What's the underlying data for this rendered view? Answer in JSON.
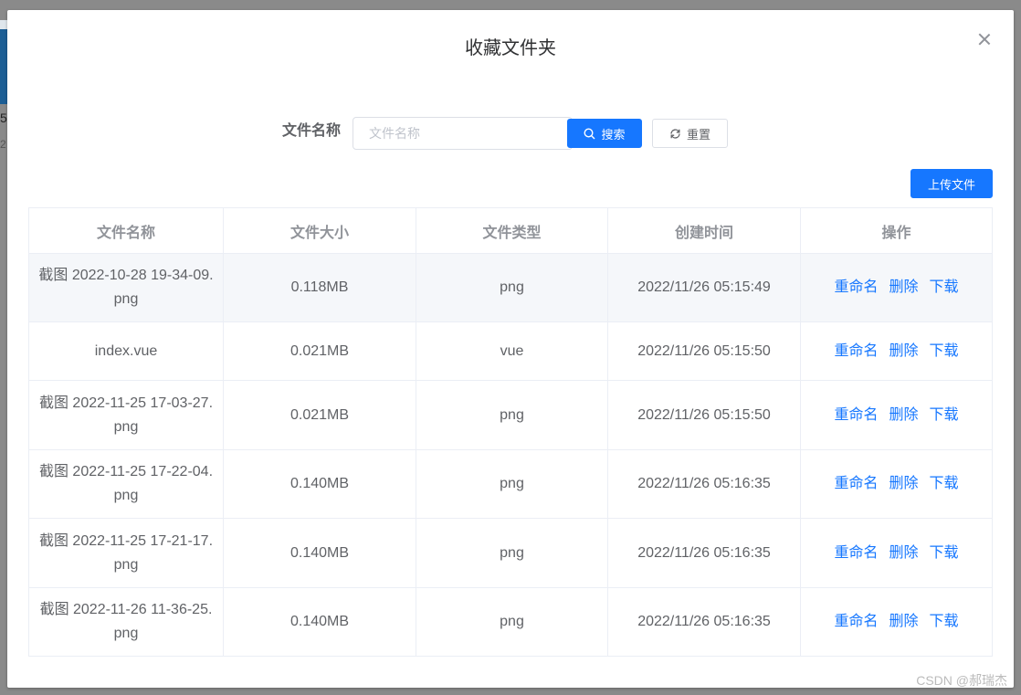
{
  "background": {
    "text1": "5",
    "text2": "2"
  },
  "dialog": {
    "title": "收藏文件夹"
  },
  "search": {
    "label": "文件名称",
    "placeholder": "文件名称",
    "value": "",
    "search_label": "搜索",
    "reset_label": "重置"
  },
  "upload_label": "上传文件",
  "table": {
    "headers": [
      "文件名称",
      "文件大小",
      "文件类型",
      "创建时间",
      "操作"
    ],
    "rows": [
      {
        "name_line1": "截图 2022-10-28 19-34-09.",
        "name_line2": "png",
        "size": "0.118MB",
        "type": "png",
        "created": "2022/11/26 05:15:49"
      },
      {
        "name_line1": "index.vue",
        "name_line2": "",
        "size": "0.021MB",
        "type": "vue",
        "created": "2022/11/26 05:15:50"
      },
      {
        "name_line1": "截图 2022-11-25 17-03-27.",
        "name_line2": "png",
        "size": "0.021MB",
        "type": "png",
        "created": "2022/11/26 05:15:50"
      },
      {
        "name_line1": "截图 2022-11-25 17-22-04.",
        "name_line2": "png",
        "size": "0.140MB",
        "type": "png",
        "created": "2022/11/26 05:16:35"
      },
      {
        "name_line1": "截图 2022-11-25 17-21-17.",
        "name_line2": "png",
        "size": "0.140MB",
        "type": "png",
        "created": "2022/11/26 05:16:35"
      },
      {
        "name_line1": "截图 2022-11-26 11-36-25.",
        "name_line2": "png",
        "size": "0.140MB",
        "type": "png",
        "created": "2022/11/26 05:16:35"
      }
    ],
    "actions": {
      "rename": "重命名",
      "delete": "删除",
      "download": "下载"
    }
  },
  "watermark": "CSDN @郝瑞杰",
  "colors": {
    "primary": "#1677ff",
    "text": "#606266",
    "header": "#909399",
    "border": "#ebeef5"
  }
}
